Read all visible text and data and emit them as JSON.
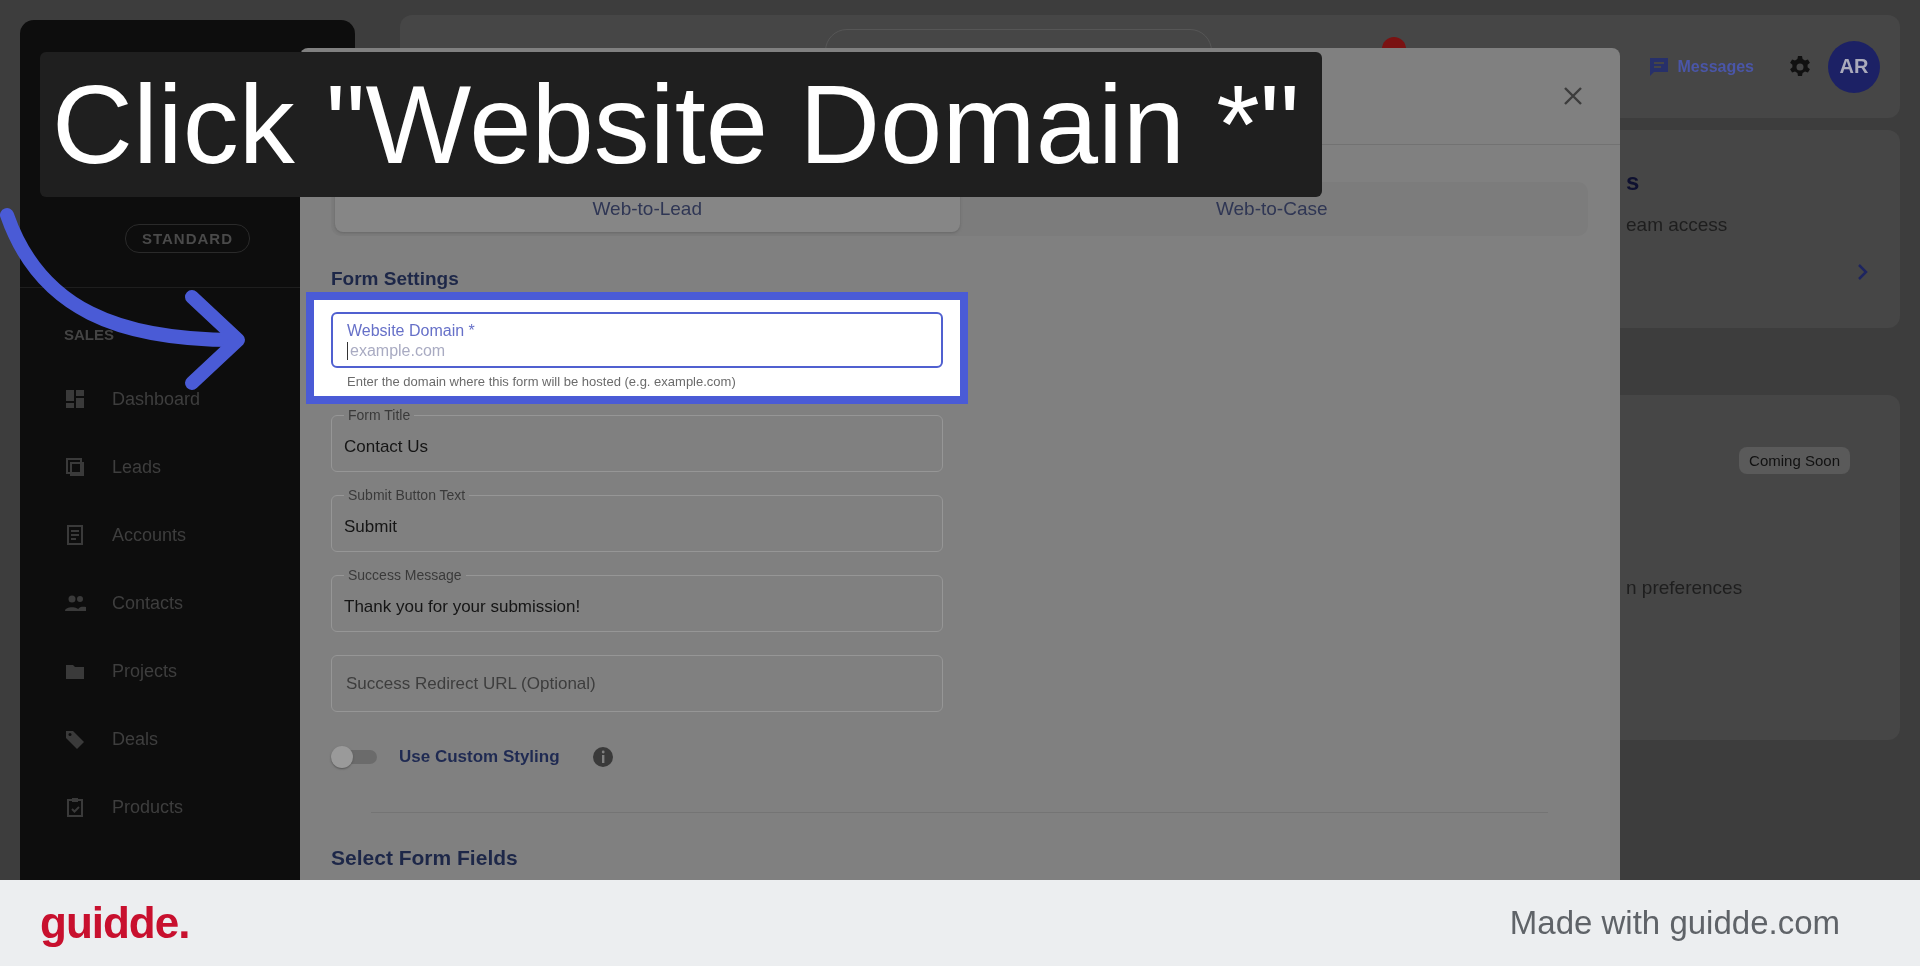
{
  "sidebar": {
    "badge": "STANDARD",
    "section": "SALES",
    "items": [
      {
        "label": "Dashboard"
      },
      {
        "label": "Leads"
      },
      {
        "label": "Accounts"
      },
      {
        "label": "Contacts"
      },
      {
        "label": "Projects"
      },
      {
        "label": "Deals"
      },
      {
        "label": "Products"
      }
    ]
  },
  "topbar": {
    "messages": "Messages",
    "avatar": "AR"
  },
  "background_cards": [
    {
      "title": "s",
      "subtitle": "eam access"
    },
    {
      "badge": "Coming Soon",
      "subtitle": "n preferences"
    }
  ],
  "dialog": {
    "tabs": [
      {
        "label": "Web-to-Lead",
        "selected": true
      },
      {
        "label": "Web-to-Case",
        "selected": false
      }
    ],
    "section": "Form Settings",
    "fields": [
      {
        "kind": "focused",
        "label": "Website Domain *",
        "placeholder": "example.com",
        "helper": "Enter the domain where this form will be hosted (e.g. example.com)"
      },
      {
        "kind": "filled",
        "label": "Form Title",
        "value": "Contact Us"
      },
      {
        "kind": "filled",
        "label": "Submit Button Text",
        "value": "Submit"
      },
      {
        "kind": "filled",
        "label": "Success Message",
        "value": "Thank you for your submission!"
      },
      {
        "kind": "empty",
        "placeholder": "Success Redirect URL (Optional)"
      }
    ],
    "toggle": {
      "label": "Use Custom Styling",
      "on": false
    },
    "next_section": "Select Form Fields"
  },
  "caption": "Click \"Website Domain *\"",
  "footer": {
    "logo": "guidde.",
    "credit": "Made with guidde.com"
  }
}
